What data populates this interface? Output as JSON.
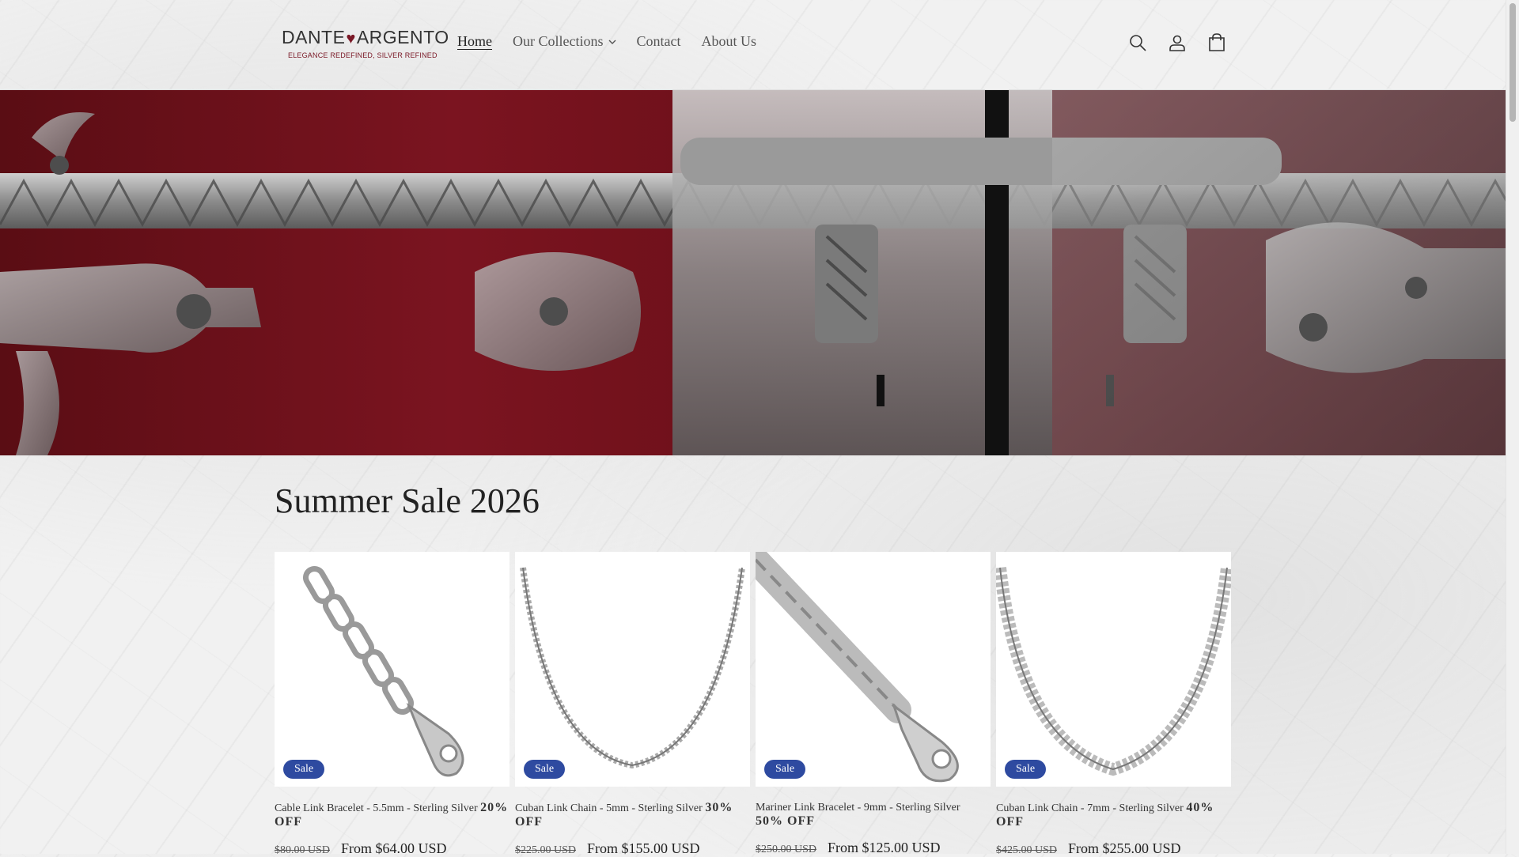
{
  "header": {
    "brand_left": "DANTE",
    "brand_right": "ARGENTO",
    "tagline": "ELEGANCE REDEFINED, SILVER REFINED",
    "nav": [
      {
        "label": "Home",
        "active": true
      },
      {
        "label": "Our Collections",
        "dropdown": true
      },
      {
        "label": "Contact"
      },
      {
        "label": "About Us"
      }
    ],
    "icons": [
      "search-icon",
      "account-icon",
      "cart-icon"
    ]
  },
  "section": {
    "title": "Summer Sale 2026"
  },
  "products": [
    {
      "badge": "Sale",
      "name": "Cable Link Bracelet - 5.5mm - Sterling Silver",
      "discount_pct": "20",
      "discount_suffix": "OFF",
      "compare_price": "$80.00 USD",
      "price": "From $64.00 USD"
    },
    {
      "badge": "Sale",
      "name": "Cuban Link Chain - 5mm - Sterling Silver",
      "discount_pct": "30",
      "discount_suffix": "OFF",
      "compare_price": "$225.00 USD",
      "price": "From $155.00 USD"
    },
    {
      "badge": "Sale",
      "name": "Mariner Link Bracelet - 9mm - Sterling Silver",
      "discount_pct": "50",
      "discount_suffix": "OFF",
      "compare_price": "$250.00 USD",
      "price": "From $125.00 USD"
    },
    {
      "badge": "Sale",
      "name": "Cuban Link Chain - 7mm - Sterling Silver",
      "discount_pct": "40",
      "discount_suffix": "OFF",
      "compare_price": "$425.00 USD",
      "price": "From $255.00 USD"
    }
  ],
  "colors": {
    "brand_accent": "#7a1826",
    "badge": "#2e4aa0",
    "hero_velvet": "#6a0f18"
  }
}
